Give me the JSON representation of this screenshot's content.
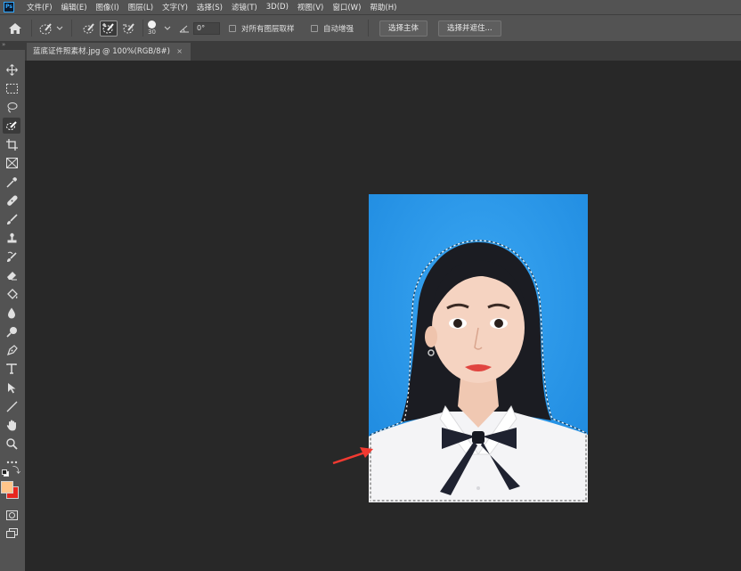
{
  "app": {
    "logo_text": "Ps",
    "menu": [
      "文件(F)",
      "编辑(E)",
      "图像(I)",
      "图层(L)",
      "文字(Y)",
      "选择(S)",
      "滤镜(T)",
      "3D(D)",
      "视图(V)",
      "窗口(W)",
      "帮助(H)"
    ]
  },
  "options": {
    "brush_size": "30",
    "angle_value": "0°",
    "sample_all_layers_label": "对所有图层取样",
    "auto_enhance_label": "自动增强",
    "select_subject_label": "选择主体",
    "select_and_mask_label": "选择并遮住..."
  },
  "document": {
    "tab_title": "蓝底证件照素材.jpg @ 100%(RGB/8#)",
    "close_glyph": "×"
  },
  "tools": [
    "move-tool",
    "rectangular-marquee-tool",
    "lasso-tool",
    "quick-selection-tool",
    "crop-tool",
    "frame-tool",
    "eyedropper-tool",
    "spot-healing-brush-tool",
    "brush-tool",
    "clone-stamp-tool",
    "history-brush-tool",
    "eraser-tool",
    "paint-bucket-tool",
    "blur-tool",
    "dodge-tool",
    "pen-tool",
    "type-tool",
    "path-selection-tool",
    "line-tool",
    "hand-tool",
    "zoom-tool",
    "edit-toolbar"
  ],
  "colors": {
    "foreground": "#ffc58a",
    "background": "#e8261e",
    "photo_background": "#2c96e8",
    "annotation_arrow": "#f23a31"
  },
  "panel_collapse_glyph": "»"
}
